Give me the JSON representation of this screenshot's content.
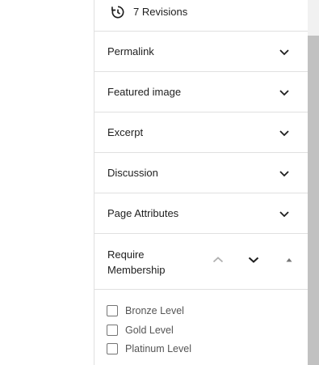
{
  "revisions": {
    "label": "7 Revisions",
    "icon": "history-icon"
  },
  "panels": [
    {
      "title": "Permalink",
      "state": "collapsed"
    },
    {
      "title": "Featured image",
      "state": "collapsed"
    },
    {
      "title": "Excerpt",
      "state": "collapsed"
    },
    {
      "title": "Discussion",
      "state": "collapsed"
    },
    {
      "title": "Page Attributes",
      "state": "collapsed"
    }
  ],
  "membership": {
    "title": "Require Membership",
    "state": "expanded",
    "controls": [
      "move-up-icon",
      "move-down-icon",
      "collapse-caret-icon"
    ],
    "options": [
      {
        "label": "Bronze Level",
        "checked": false
      },
      {
        "label": "Gold Level",
        "checked": false
      },
      {
        "label": "Platinum Level",
        "checked": false
      }
    ]
  },
  "colors": {
    "text": "#1e1e1e",
    "muted_text": "#555555",
    "border": "#e0e0e0",
    "scrollbar_thumb": "#c1c1c1"
  }
}
